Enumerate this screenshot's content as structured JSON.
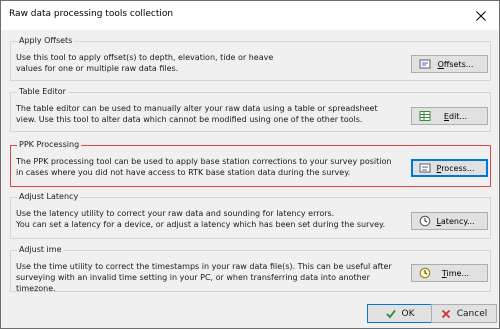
{
  "window": {
    "title": "Raw data processing tools collection"
  },
  "groups": [
    {
      "label": "Apply Offsets",
      "desc_lines": [
        "Use this tool to apply offset(s) to depth, elevation, tide or heave",
        "values for one or multiple raw data files."
      ],
      "button_mnemonic": "O",
      "button_rest": "ffsets...",
      "icon": "offsets-icon"
    },
    {
      "label": "Table Editor",
      "desc_lines": [
        "The table editor can be used to manually alter your raw data using a table or spreadsheet",
        "view. Use this tool to alter data which cannot be modified using one of the other tools."
      ],
      "button_mnemonic": "E",
      "button_rest": "dit...",
      "icon": "table-icon"
    },
    {
      "label": "PPK Processing",
      "desc_lines": [
        "The PPK processing tool can be used to apply base station corrections to your survey position",
        "in cases where you did not have access to RTK base station data during the survey."
      ],
      "button_mnemonic": "P",
      "button_rest": "rocess...",
      "icon": "process-icon"
    },
    {
      "label": "Adjust Latency",
      "desc_lines": [
        "Use the latency utility to correct your raw data and sounding for latency errors.",
        "You can set a latency for a device, or adjust a latency which has been set during the survey."
      ],
      "button_mnemonic": "L",
      "button_rest": "atency...",
      "icon": "clock-icon"
    },
    {
      "label": "Adjust ime",
      "desc_lines": [
        "Use the time utility to correct the timestamps in your raw data file(s). This can be useful after",
        "surveying with an invalid time setting in your PC, or when transferring data into another timezone."
      ],
      "button_mnemonic": "T",
      "button_rest": "ime...",
      "icon": "clock-adjust-icon"
    }
  ],
  "footer": {
    "ok_label": "OK",
    "cancel_label": "Cancel"
  },
  "colors": {
    "highlight_border": "#e04848",
    "focus_blue": "#0078d7",
    "ok_check": "#2a8a2a",
    "cancel_x": "#d03030"
  }
}
